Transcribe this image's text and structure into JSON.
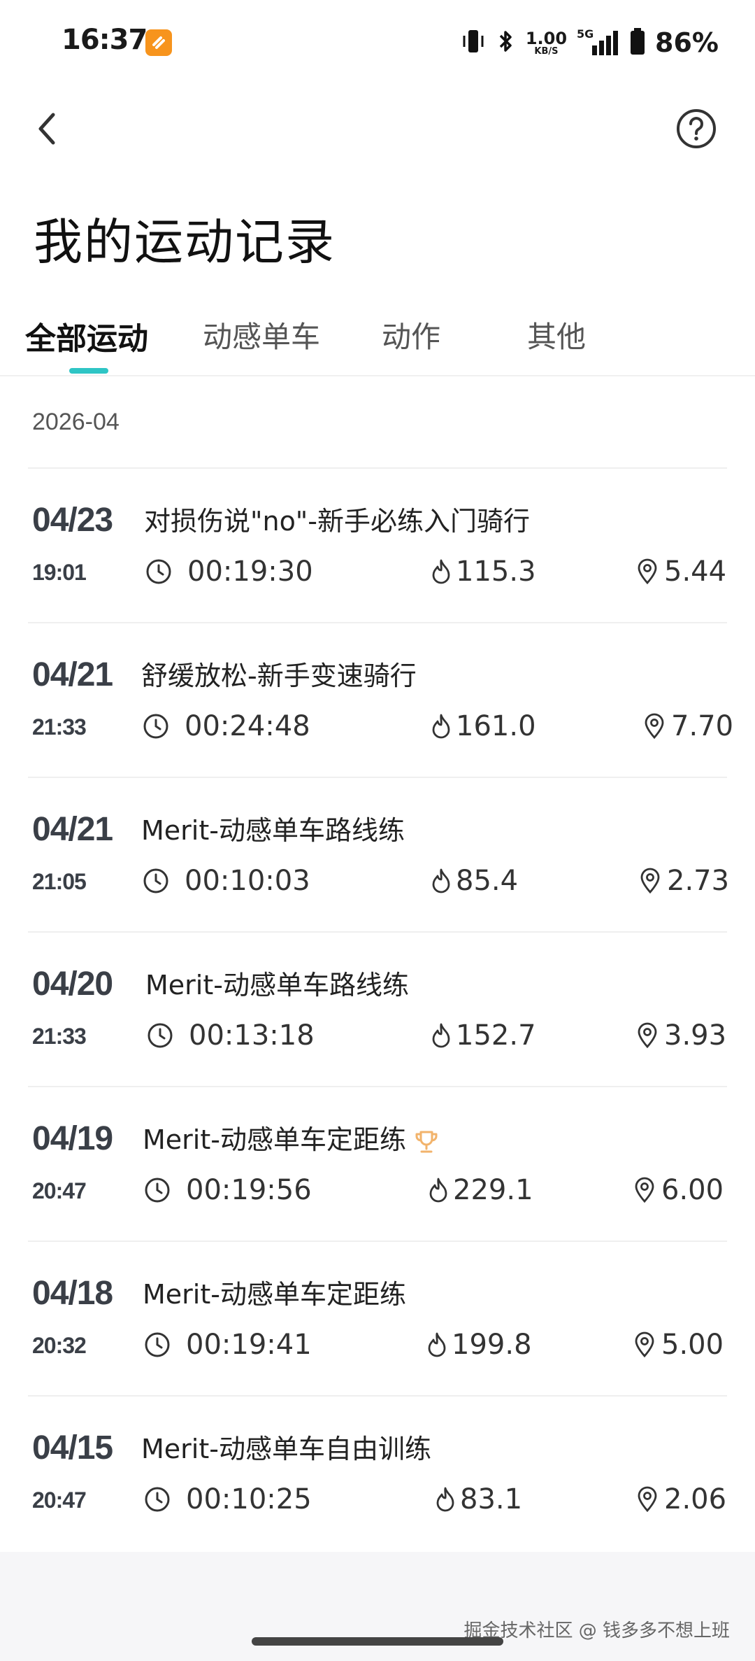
{
  "status_bar": {
    "time": "16:37",
    "speed_value": "1.00",
    "speed_unit": "KB/S",
    "network": "5G",
    "battery": "86%"
  },
  "header": {
    "title": "我的运动记录"
  },
  "tabs": [
    {
      "label": "全部运动"
    },
    {
      "label": "动感单车"
    },
    {
      "label": "动作"
    },
    {
      "label": "其他"
    }
  ],
  "month": "2026-04",
  "records": [
    {
      "date": "04/23",
      "time": "19:01",
      "title": "对损伤说\"no\"-新手必练入门骑行",
      "duration": "00:19:30",
      "calories": "115.3",
      "distance": "5.44"
    },
    {
      "date": "04/21",
      "time": "21:33",
      "title": "舒缓放松-新手变速骑行",
      "duration": "00:24:48",
      "calories": "161.0",
      "distance": "7.70"
    },
    {
      "date": "04/21",
      "time": "21:05",
      "title": "Merit-动感单车路线练",
      "duration": "00:10:03",
      "calories": "85.4",
      "distance": "2.73"
    },
    {
      "date": "04/20",
      "time": "21:33",
      "title": "Merit-动感单车路线练",
      "duration": "00:13:18",
      "calories": "152.7",
      "distance": "3.93"
    },
    {
      "date": "04/19",
      "time": "20:47",
      "title": "Merit-动感单车定距练",
      "duration": "00:19:56",
      "calories": "229.1",
      "distance": "6.00"
    },
    {
      "date": "04/18",
      "time": "20:32",
      "title": "Merit-动感单车定距练",
      "duration": "00:19:41",
      "calories": "199.8",
      "distance": "5.00"
    },
    {
      "date": "04/15",
      "time": "20:47",
      "title": "Merit-动感单车自由训练",
      "duration": "00:10:25",
      "calories": "83.1",
      "distance": "2.06"
    }
  ],
  "watermark": "掘金技术社区 @ 钱多多不想上班",
  "colors": {
    "accent": "#2ec5c5",
    "trophy": "#f2b36b",
    "app_icon": "#f7941d"
  }
}
